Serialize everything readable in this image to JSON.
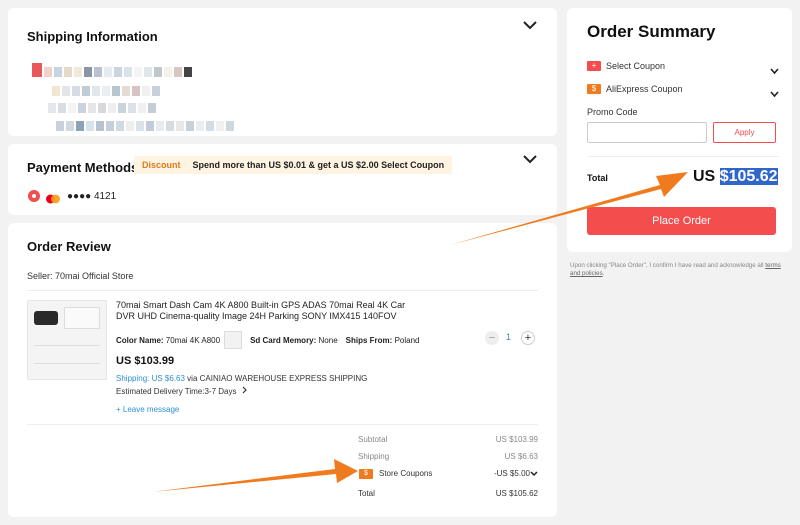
{
  "shipping": {
    "title": "Shipping Information"
  },
  "payment": {
    "title": "Payment Methods",
    "discount_tag": "Discount",
    "promo_text": "Spend more than US $0.01 & get a US $2.00 Select Coupon",
    "card_dots": "●●●● 4121"
  },
  "review": {
    "title": "Order Review",
    "seller": "Seller: 70mai Official Store",
    "product_title": "70mai Smart Dash Cam 4K A800 Built-in GPS ADAS 70mai Real 4K Car DVR UHD Cinema-quality Image 24H Parking SONY IMX415 140FOV",
    "color_label": "Color Name:",
    "color_value": "70mai 4K A800",
    "sd_label": "Sd Card Memory:",
    "sd_value": "None",
    "ships_label": "Ships From:",
    "ships_value": "Poland",
    "price": "US $103.99",
    "shipping_price": "Shipping: US $6.63",
    "shipping_via": " via CAINIAO WAREHOUSE EXPRESS SHIPPING",
    "delivery": "Estimated Delivery Time:3-7 Days",
    "leave_message": "+ Leave message",
    "quantity": "1",
    "minus": "−",
    "plus": "+"
  },
  "totals": {
    "subtotal_label": "Subtotal",
    "subtotal_value": "US $103.99",
    "shipping_label": "Shipping",
    "shipping_value": "US $6.63",
    "coupons_label": "Store Coupons",
    "coupons_value": "-US $5.00",
    "total_label": "Total",
    "total_value": "US $105.62",
    "coupon_icon_text": "$"
  },
  "summary": {
    "title": "Order Summary",
    "select_coupon": "Select Coupon",
    "aliexpress_coupon": "AliExpress Coupon",
    "promo_label": "Promo Code",
    "promo_placeholder": "",
    "apply": "Apply",
    "total_label": "Total",
    "total_currency": "US",
    "total_amount": "$105.62",
    "place_order": "Place Order",
    "disclaimer": "Upon clicking \"Place Order\", I confirm I have read and acknowledge all ",
    "disclaimer_link": "terms and policies",
    "disclaimer_end": ".",
    "select_icon_text": "+",
    "ali_icon_text": "$"
  },
  "colors": {
    "accent_red": "#f44d4d",
    "arrow_orange": "#f07a1e",
    "shipping_blue": "#2f8fd4",
    "highlight_blue": "#2f66c8"
  }
}
